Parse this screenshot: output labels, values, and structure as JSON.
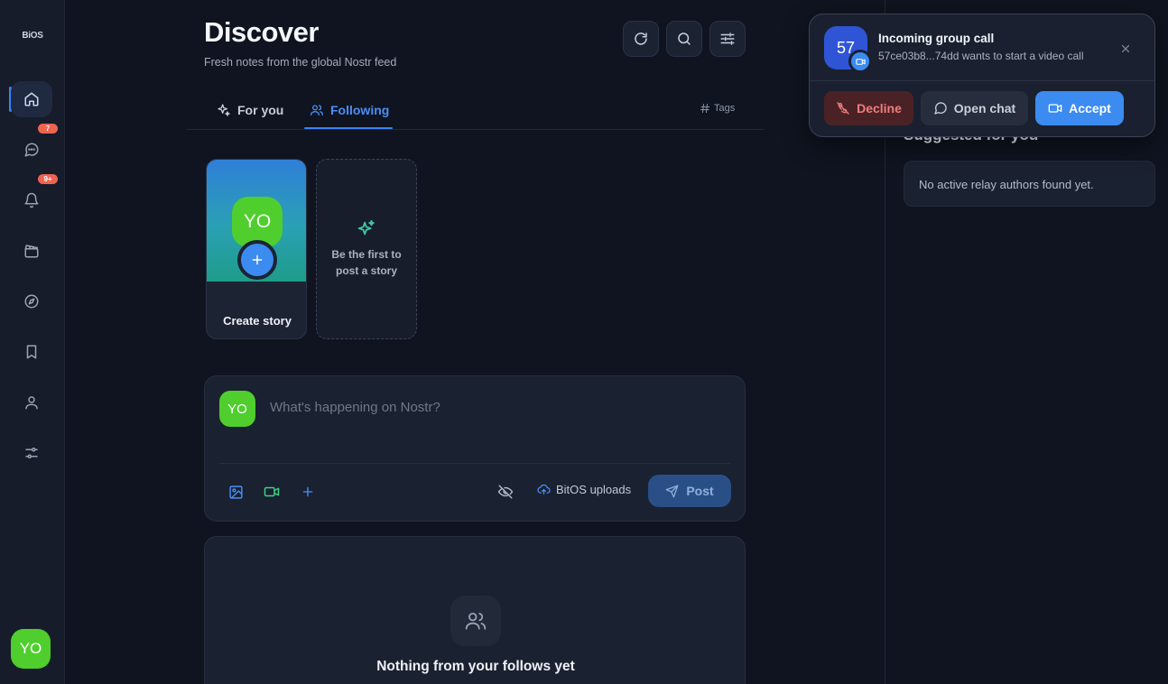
{
  "app": {
    "logo_text": "BiOS"
  },
  "sidebar": {
    "badges": {
      "messages": "7",
      "notifications": "9+"
    },
    "user_initials": "YO"
  },
  "header": {
    "title": "Discover",
    "subtitle": "Fresh notes from the global Nostr feed"
  },
  "tabs": {
    "for_you": "For you",
    "following": "Following",
    "tags": "Tags",
    "active": "following"
  },
  "stories": {
    "create_label": "Create story",
    "avatar_initials": "YO",
    "empty_text": "Be the first to post a story"
  },
  "composer": {
    "avatar_initials": "YO",
    "placeholder": "What's happening on Nostr?",
    "value": "",
    "uploads_label": "BitOS uploads",
    "post_label": "Post"
  },
  "feed": {
    "empty_title": "Nothing from your follows yet"
  },
  "suggestions": {
    "title": "Suggested for you",
    "empty_text": "No active relay authors found yet."
  },
  "call": {
    "avatar_text": "57",
    "title": "Incoming group call",
    "subtitle": "57ce03b8...74dd wants to start a video call",
    "decline_label": "Decline",
    "chat_label": "Open chat",
    "accept_label": "Accept"
  },
  "colors": {
    "background": "#0f1420",
    "accent": "#3b82f6",
    "avatar_green": "#4fce2e",
    "badge_red": "#ef6351",
    "decline_bg": "#4a2226"
  }
}
